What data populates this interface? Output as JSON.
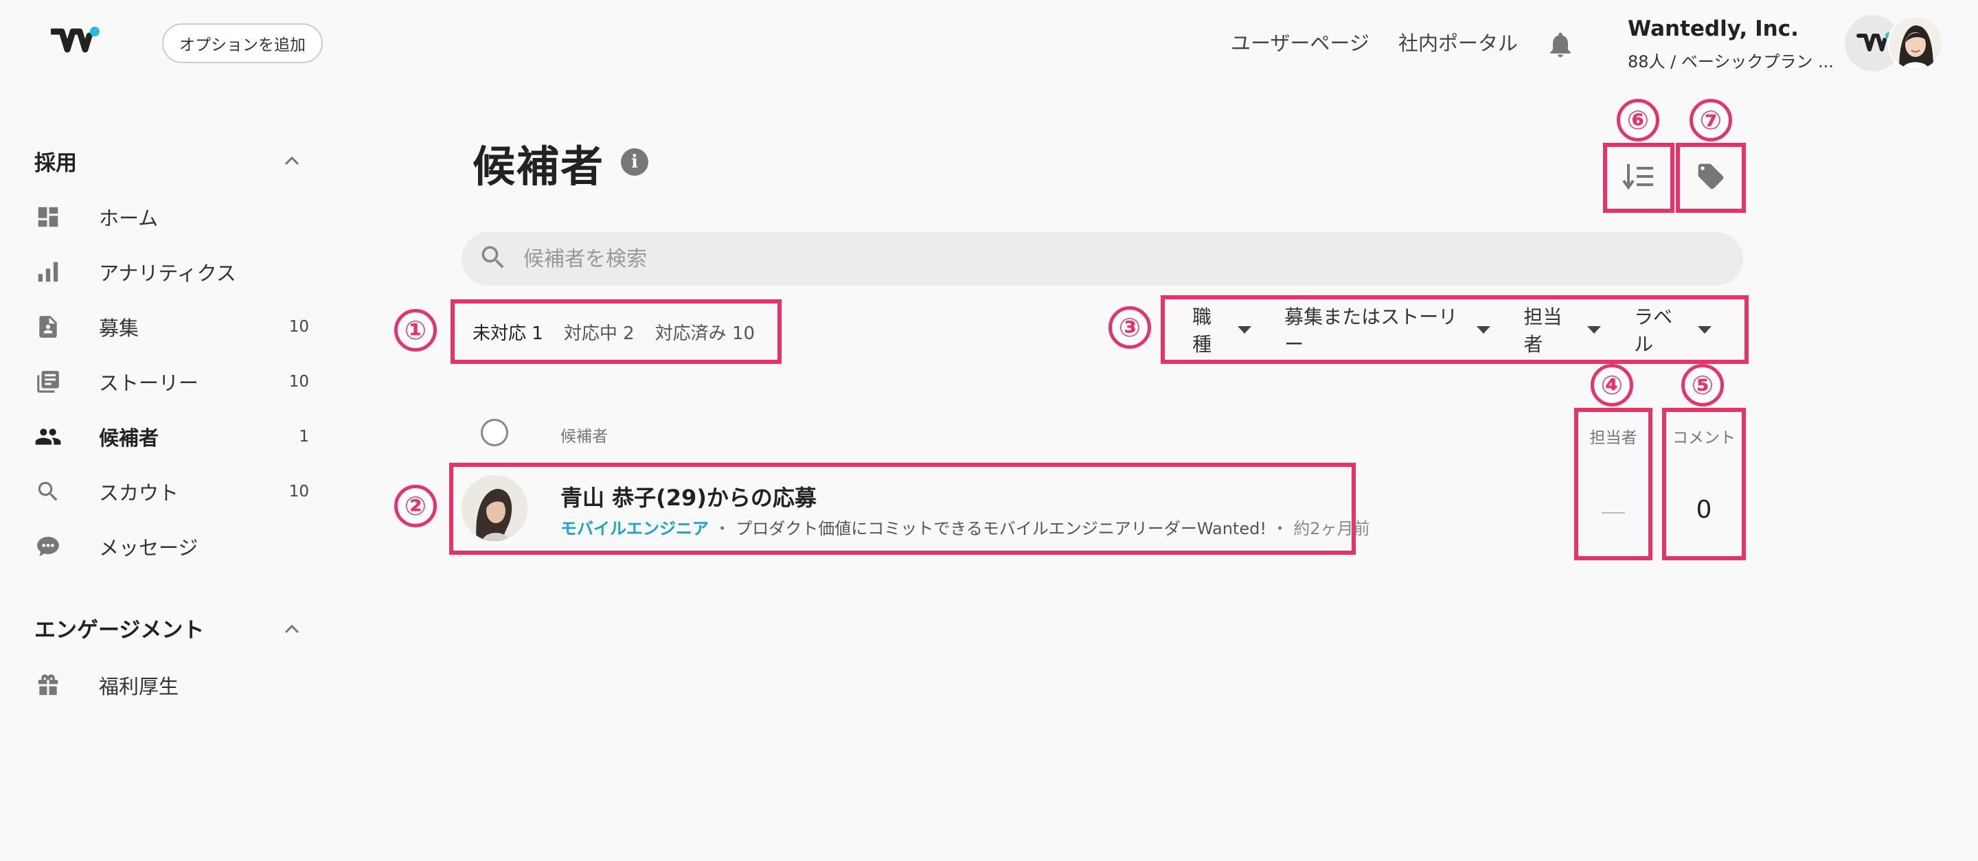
{
  "header": {
    "add_option_label": "オプションを追加",
    "links": [
      "ユーザーページ",
      "社内ポータル"
    ],
    "company_name": "Wantedly, Inc.",
    "plan_text": "88人 / ベーシックプラン ..."
  },
  "sidebar": {
    "sections": [
      {
        "title": "採用",
        "items": [
          {
            "label": "ホーム",
            "count": "",
            "icon": "dashboard-icon"
          },
          {
            "label": "アナリティクス",
            "count": "",
            "icon": "bar-chart-icon"
          },
          {
            "label": "募集",
            "count": "10",
            "icon": "recruit-document-icon"
          },
          {
            "label": "ストーリー",
            "count": "10",
            "icon": "story-icon"
          },
          {
            "label": "候補者",
            "count": "1",
            "icon": "people-icon",
            "active": true
          },
          {
            "label": "スカウト",
            "count": "10",
            "icon": "search-icon"
          },
          {
            "label": "メッセージ",
            "count": "",
            "icon": "chat-bubble-icon"
          }
        ]
      },
      {
        "title": "エンゲージメント",
        "items": [
          {
            "label": "福利厚生",
            "count": "",
            "icon": "gift-icon"
          }
        ]
      }
    ]
  },
  "main": {
    "title": "候補者",
    "search_placeholder": "候補者を検索",
    "tabs": [
      {
        "label": "未対応",
        "count": "1",
        "active": true
      },
      {
        "label": "対応中",
        "count": "2"
      },
      {
        "label": "対応済み",
        "count": "10"
      }
    ],
    "filters": [
      "職種",
      "募集またはストーリー",
      "担当者",
      "ラベル"
    ],
    "columns": {
      "candidate": "候補者",
      "owner": "担当者",
      "comment": "コメント"
    },
    "candidates": [
      {
        "name": "青山 恭子(29)からの応募",
        "role": "モバイルエンジニア",
        "job": "プロダクト価値にコミットできるモバイルエンジニアリーダーWanted!",
        "time": "約2ヶ月前",
        "owner": "—",
        "comments": "0"
      }
    ]
  },
  "annotations": [
    "①",
    "②",
    "③",
    "④",
    "⑤",
    "⑥",
    "⑦"
  ],
  "colors": {
    "highlight": "#e8336a",
    "accent": "#1aa3cf"
  }
}
